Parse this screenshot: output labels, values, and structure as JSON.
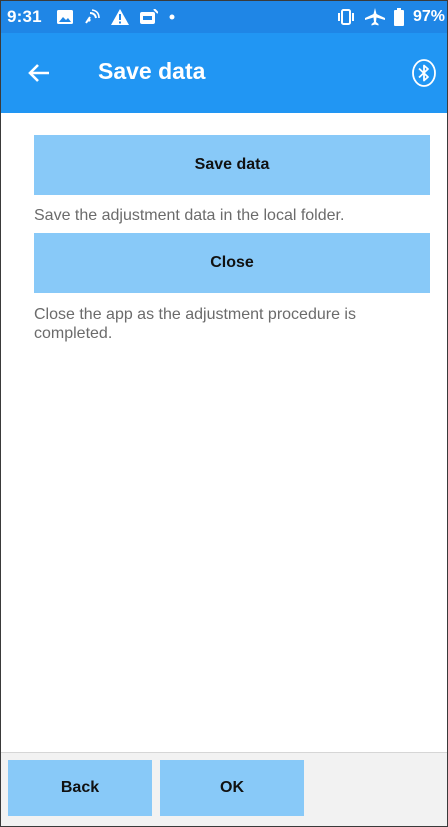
{
  "status_bar": {
    "time": "9:31",
    "battery_percent": "97%",
    "left_icons": [
      "image-icon",
      "cast-icon",
      "warning-icon",
      "app-icon",
      "dot-icon"
    ],
    "right_icons": [
      "vibrate-icon",
      "airplane-icon",
      "battery-icon"
    ]
  },
  "app_bar": {
    "title": "Save data",
    "back_icon": "arrow-back-icon",
    "action_icon": "bluetooth-icon"
  },
  "main": {
    "save_button_label": "Save data",
    "save_description": "Save the adjustment data in the local folder.",
    "close_button_label": "Close",
    "close_description": "Close the app as the adjustment procedure is completed."
  },
  "bottom_nav": {
    "back_label": "Back",
    "ok_label": "OK"
  },
  "colors": {
    "status_bar": "#1f86e6",
    "app_bar": "#2196f3",
    "button": "#88c9f8",
    "description_text": "#6b6b6b",
    "bottom_area": "#f2f2f2"
  }
}
